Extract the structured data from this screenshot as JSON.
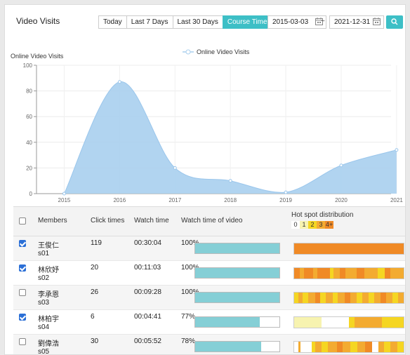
{
  "header": {
    "title": "Video Visits",
    "ranges": [
      "Today",
      "Last 7 Days",
      "Last 30 Days",
      "Course Time"
    ],
    "active_range": "Course Time",
    "start_date": "2015-03-03",
    "separator": "~",
    "end_date": "2021-12-31"
  },
  "chart_data": {
    "type": "area",
    "title": "Online Video Visits",
    "legend": "Online Video Visits",
    "legend_position": "top-center",
    "x": [
      "2015",
      "2016",
      "2017",
      "2018",
      "2019",
      "2020",
      "2021"
    ],
    "series": [
      {
        "name": "Online Video Visits",
        "values": [
          0,
          87,
          20,
          10,
          1,
          22,
          34
        ]
      }
    ],
    "ylim": [
      0,
      100
    ],
    "yticks": [
      0,
      20,
      40,
      60,
      80,
      100
    ],
    "grid": true,
    "color": "#a9cfee"
  },
  "table": {
    "headers": {
      "members": "Members",
      "clicks": "Click times",
      "watch": "Watch time",
      "video": "Watch time of video",
      "hotspot": "Hot spot distribution"
    },
    "legend": [
      "0",
      "1",
      "2",
      "3",
      "4+"
    ],
    "legend_colors": [
      "#ffffff",
      "#f7f3b0",
      "#f5d623",
      "#f3ab31",
      "#f08a26"
    ],
    "rows": [
      {
        "checked": true,
        "name": "王俊仁",
        "id": "s01",
        "clicks": "119",
        "watch": "00:30:04",
        "pct_label": "100%",
        "pct": 1.0,
        "heat": [
          [
            1.0,
            4
          ]
        ]
      },
      {
        "checked": true,
        "name": "林欣妤",
        "id": "s02",
        "clicks": "20",
        "watch": "00:11:03",
        "pct_label": "100%",
        "pct": 1.0,
        "heat": [
          [
            0.05,
            4
          ],
          [
            0.04,
            3
          ],
          [
            0.08,
            4
          ],
          [
            0.04,
            3
          ],
          [
            0.12,
            4
          ],
          [
            0.03,
            2
          ],
          [
            0.06,
            3
          ],
          [
            0.05,
            4
          ],
          [
            0.1,
            3
          ],
          [
            0.07,
            4
          ],
          [
            0.12,
            3
          ],
          [
            0.07,
            2
          ],
          [
            0.05,
            4
          ],
          [
            0.12,
            3
          ]
        ]
      },
      {
        "checked": false,
        "name": "李承恩",
        "id": "s03",
        "clicks": "26",
        "watch": "00:09:28",
        "pct_label": "100%",
        "pct": 1.0,
        "heat": [
          [
            0.04,
            2
          ],
          [
            0.04,
            3
          ],
          [
            0.05,
            2
          ],
          [
            0.06,
            3
          ],
          [
            0.05,
            4
          ],
          [
            0.05,
            2
          ],
          [
            0.06,
            3
          ],
          [
            0.05,
            2
          ],
          [
            0.06,
            3
          ],
          [
            0.05,
            4
          ],
          [
            0.06,
            3
          ],
          [
            0.05,
            2
          ],
          [
            0.06,
            3
          ],
          [
            0.05,
            2
          ],
          [
            0.06,
            3
          ],
          [
            0.05,
            4
          ],
          [
            0.06,
            3
          ],
          [
            0.05,
            2
          ],
          [
            0.05,
            3
          ]
        ]
      },
      {
        "checked": true,
        "name": "林柏宇",
        "id": "s04",
        "clicks": "6",
        "watch": "00:04:41",
        "pct_label": "77%",
        "pct": 0.77,
        "heat": [
          [
            0.25,
            1
          ],
          [
            0.12,
            0
          ],
          [
            0.13,
            0
          ],
          [
            0.05,
            2
          ],
          [
            0.25,
            3
          ],
          [
            0.2,
            2
          ]
        ]
      },
      {
        "checked": false,
        "name": "劉偉浩",
        "id": "s05",
        "clicks": "30",
        "watch": "00:05:52",
        "pct_label": "78%",
        "pct": 0.78,
        "heat": [
          [
            0.04,
            0
          ],
          [
            0.02,
            3
          ],
          [
            0.1,
            0
          ],
          [
            0.03,
            2
          ],
          [
            0.06,
            3
          ],
          [
            0.06,
            2
          ],
          [
            0.08,
            3
          ],
          [
            0.05,
            4
          ],
          [
            0.07,
            3
          ],
          [
            0.07,
            2
          ],
          [
            0.07,
            3
          ],
          [
            0.06,
            4
          ],
          [
            0.06,
            0
          ],
          [
            0.05,
            3
          ],
          [
            0.06,
            2
          ],
          [
            0.06,
            3
          ],
          [
            0.06,
            2
          ]
        ]
      }
    ]
  }
}
